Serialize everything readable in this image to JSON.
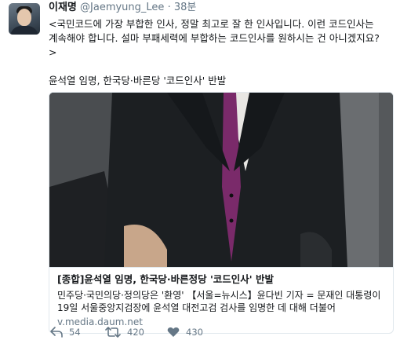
{
  "author": {
    "name": "이재명",
    "handle": "@Jaemyung_Lee",
    "time": "38분"
  },
  "tweet": {
    "line1": "<국민코드에 가장 부합한 인사, 정말 최고로 잘 한 인사입니다. 이런 코드인사는 계속해야 합니다. 설마 부패세력에 부합하는 코드인사를 원하시는 건 아니겠지요?",
    "line2": ">",
    "line3": "윤석열 임명, 한국당·바른당 '코드인사' 반발"
  },
  "card": {
    "title": "[종합]윤석열 임명, 한국당·바른정당 '코드인사' 반발",
    "description": "민주당·국민의당·정의당은 '환영' 【서울=뉴시스】윤다빈 기자 = 문재인 대통령이 19일 서울중앙지검장에 윤석열 대전고검 검사를 임명한 데 대해 더불어",
    "domain": "v.media.daum.net"
  },
  "actions": {
    "reply_count": "54",
    "retweet_count": "420",
    "like_count": "430"
  },
  "icons": {
    "reply": "reply-icon",
    "retweet": "retweet-icon",
    "like": "heart-icon"
  },
  "colors": {
    "text": "#14171a",
    "muted": "#657786",
    "border": "#e1e8ed",
    "tie": "#7a2a6a"
  }
}
